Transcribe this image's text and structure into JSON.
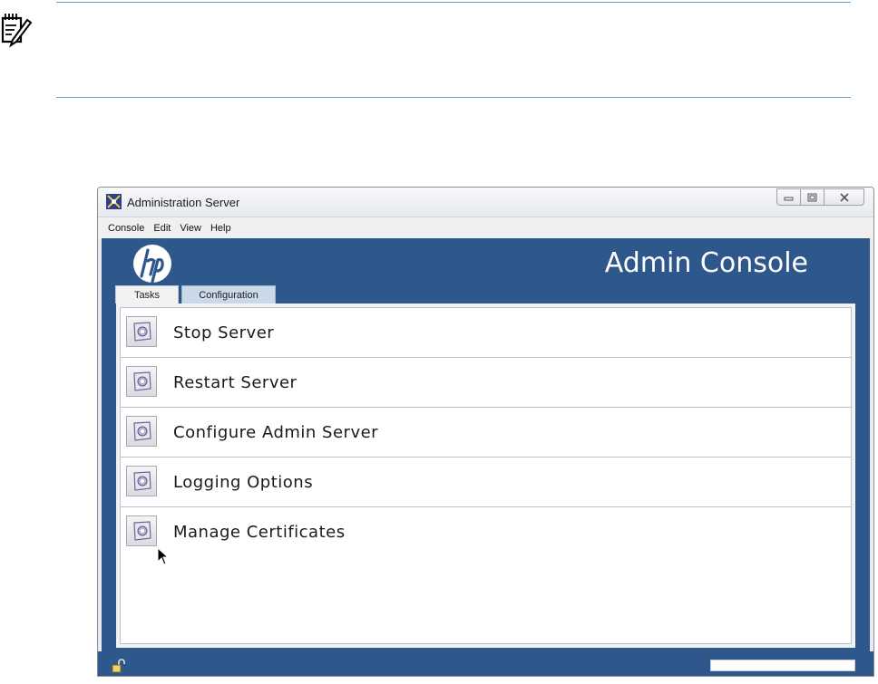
{
  "window": {
    "title": "Administration Server",
    "controls": [
      "minimize",
      "maximize",
      "close"
    ]
  },
  "menu": [
    "Console",
    "Edit",
    "View",
    "Help"
  ],
  "banner": {
    "title": "Admin Console",
    "logo": "hp-logo",
    "color": "#2e578c"
  },
  "tabs": [
    {
      "label": "Tasks",
      "selected": true
    },
    {
      "label": "Configuration",
      "selected": false
    }
  ],
  "tasks": [
    {
      "label": "Stop Server",
      "icon": "task-icon"
    },
    {
      "label": "Restart Server",
      "icon": "task-icon"
    },
    {
      "label": "Configure Admin Server",
      "icon": "task-icon"
    },
    {
      "label": "Logging Options",
      "icon": "task-icon"
    },
    {
      "label": "Manage Certificates",
      "icon": "task-icon"
    }
  ],
  "status": {
    "lock_icon": "unlocked-padlock-icon"
  },
  "note": {
    "icon": "note-pencil-icon"
  }
}
